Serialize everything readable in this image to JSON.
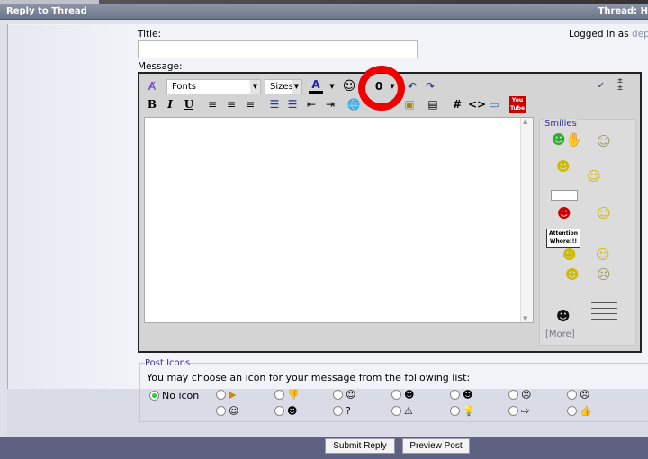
{
  "header": {
    "title": "Reply to Thread",
    "thread_label": "Thread: H"
  },
  "form": {
    "title_label": "Title:",
    "title_value": "",
    "message_label": "Message:",
    "logged_in_prefix": "Logged in as ",
    "logged_in_user": "depa"
  },
  "toolbar": {
    "fonts": "Fonts",
    "sizes": "Sizes",
    "youtube": "You Tube"
  },
  "smilies": {
    "legend": "Smilies",
    "more": "[More]",
    "sign_text": "Attention Whore!!!"
  },
  "post_icons": {
    "legend": "Post Icons",
    "instructions": "You may choose an icon for your message from the following list:",
    "no_icon": "No icon",
    "selected": "No icon"
  },
  "buttons": {
    "submit": "Submit Reply",
    "preview": "Preview Post"
  },
  "colors": {
    "header": "#7a8296",
    "annotation_circle": "#e00000",
    "button_bar": "#5f6181"
  }
}
